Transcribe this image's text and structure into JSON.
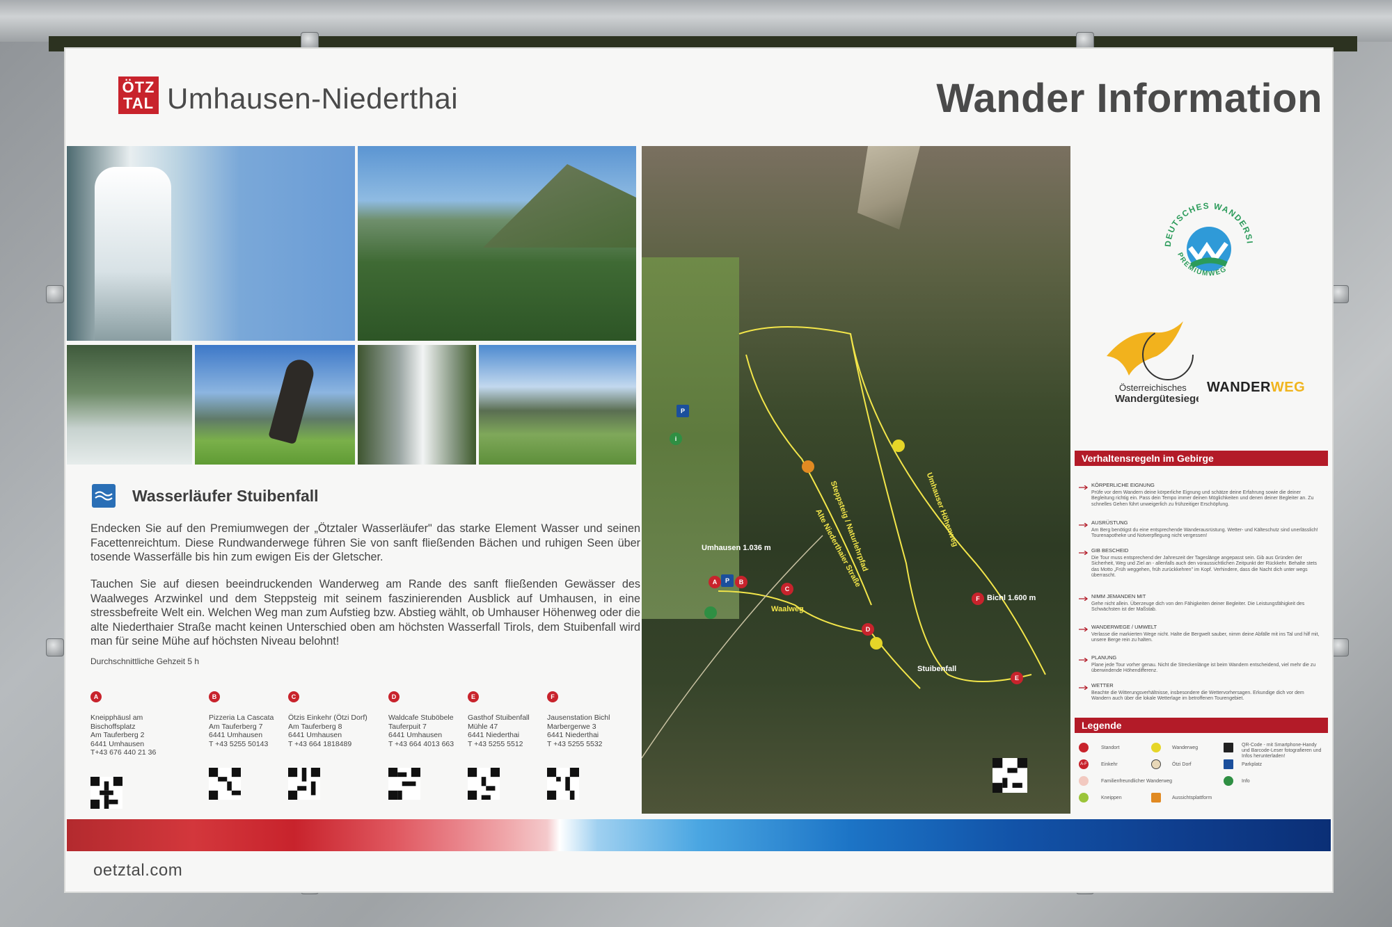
{
  "header": {
    "logo_line1": "ÖTZ",
    "logo_line2": "TAL",
    "place": "Umhausen-Niederthai",
    "title": "Wander Information"
  },
  "section": {
    "title": "Wasserläufer Stuibenfall",
    "paragraph1": "Endecken Sie auf den Premiumwegen der „Ötztaler Wasserläufer\" das starke Element Wasser und seinen Facettenreichtum. Diese Rundwanderwege führen Sie von sanft fließenden Bächen und ruhigen Seen über tosende Wasserfälle bis hin zum ewigen Eis der Gletscher.",
    "paragraph2": "Tauchen Sie auf diesen beeindruckenden Wanderweg am Rande des sanft fließenden Gewässer des Waalweges Arzwinkel und dem Steppsteig mit seinem faszinierenden Ausblick auf Umhausen, in eine stressbefreite Welt ein. Welchen Weg man zum Aufstieg bzw. Abstieg wählt, ob Umhauser Höhenweg oder die alte Niederthaier Straße macht keinen Unterschied oben am höchsten Wasserfall Tirols, dem Stuibenfall wird man für seine Mühe auf höchsten Niveau belohnt!",
    "duration": "Durchschnittliche Gehzeit 5 h"
  },
  "stops": [
    {
      "marker": "A",
      "name": "Kneipphäusl am Bischoffsplatz",
      "street": "Am Tauferberg 2",
      "city": "6441 Umhausen",
      "phone": "T+43 676 440 21 36"
    },
    {
      "marker": "B",
      "name": "Pizzeria La Cascata",
      "street": "Am Tauferberg 7",
      "city": "6441 Umhausen",
      "phone": "T +43 5255 50143"
    },
    {
      "marker": "C",
      "name": "Ötzis Einkehr (Ötzi Dorf)",
      "street": "Am Tauferberg 8",
      "city": "6441 Umhausen",
      "phone": "T +43 664 1818489"
    },
    {
      "marker": "D",
      "name": "Waldcafe Stuböbele",
      "street": "Tauferpuit 7",
      "city": "6441 Umhausen",
      "phone": "T +43 664 4013 663"
    },
    {
      "marker": "E",
      "name": "Gasthof Stuibenfall",
      "street": "Mühle 47",
      "city": "6441 Niederthai",
      "phone": "T +43 5255 5512"
    },
    {
      "marker": "F",
      "name": "Jausenstation Bichl",
      "street": "Marbergerwe 3",
      "city": "6441 Niederthai",
      "phone": "T +43 5255 5532"
    }
  ],
  "map": {
    "labels": {
      "umhausen": "Umhausen 1.036 m",
      "bichl": "Bichl 1.600 m",
      "stuibenfall": "Stuibenfall",
      "waalweg": "Waalweg",
      "alte_strasse": "Alte Niederthaier Straße",
      "steppsteig": "Steppsteig / Naturlehrpfad",
      "hoehenweg": "Umhauser Höhenweg"
    },
    "parking": "P",
    "info": "i"
  },
  "seals": {
    "deutsches": "DEUTSCHES WANDERSIEGEL",
    "premium": "PREMIUMWEG",
    "oesterreich1": "Österreichisches",
    "oesterreich2": "Wandergütesiegel",
    "wander": "WANDER",
    "weg": "WEG"
  },
  "rules": {
    "title": "Verhaltensregeln im Gebirge",
    "items": [
      {
        "head": "Körperliche Eignung",
        "text": "Prüfe vor dem Wandern deine körperliche Eignung und schätze deine Erfahrung sowie die deiner Begleitung richtig ein. Pass dein Tempo immer deinen Möglichkeiten und denen deiner Begleiter an. Zu schnelles Gehen führt unweigerlich zu frühzeitiger Erschöpfung."
      },
      {
        "head": "Ausrüstung",
        "text": "Am Berg benötigst du eine entsprechende Wanderausrüstung. Wetter- und Kälteschutz sind unerlässlich! Tourenapotheke und Notverpflegung nicht vergessen!"
      },
      {
        "head": "Gib Bescheid",
        "text": "Die Tour muss entsprechend der Jahreszeit der Tageslänge angepasst sein. Gib aus Gründen der Sicherheit, Weg und Ziel an - allenfalls auch den voraussichtlichen Zeitpunkt der Rückkehr. Behalte stets das Motto „Früh weggehen, früh zurückkehren\" im Kopf. Verhindere, dass die Nacht dich unter wegs überrascht."
      },
      {
        "head": "Nimm jemanden mit",
        "text": "Gehe nicht allein. Überzeuge dich von den Fähigkeiten deiner Begleiter. Die Leistungsfähigkeit des Schwächsten ist der Maßstab."
      },
      {
        "head": "Wanderwege / Umwelt",
        "text": "Verlasse die markierten Wege nicht. Halte die Bergwelt sauber, nimm deine Abfälle mit ins Tal und hilf mit, unsere Berge rein zu halten."
      },
      {
        "head": "Planung",
        "text": "Plane jede Tour vorher genau. Nicht die Streckenlänge ist beim Wandern entscheidend, viel mehr die zu überwindende Höhendifferenz."
      },
      {
        "head": "Wetter",
        "text": "Beachte die Witterungsverhältnisse, insbesondere die Wettervorhersagen. Erkundige dich vor dem Wandern auch über die lokale Wetterlage im betroffenen Tourengebiet."
      }
    ]
  },
  "legend": {
    "title": "Legende",
    "items": {
      "standort": "Standort",
      "wanderweg": "Wanderweg",
      "qr": "QR-Code - mit Smartphone-Handy und Barcode-Leser fotografieren und Infos herunterladen!",
      "einkehr_marker": "A-F",
      "einkehr": "Einkehr",
      "oetzi": "Ötzi Dorf",
      "parkplatz": "Parkplatz",
      "familie": "Familienfreundlicher Wanderweg",
      "info": "Info",
      "kneippen": "Kneippen",
      "aussicht": "Aussichtsplattform"
    }
  },
  "footer": {
    "url": "oetztal.com"
  },
  "colors": {
    "brand_red": "#c8232c",
    "route_yellow": "#f3e64a",
    "stripe_blue": "#1c74c6"
  }
}
